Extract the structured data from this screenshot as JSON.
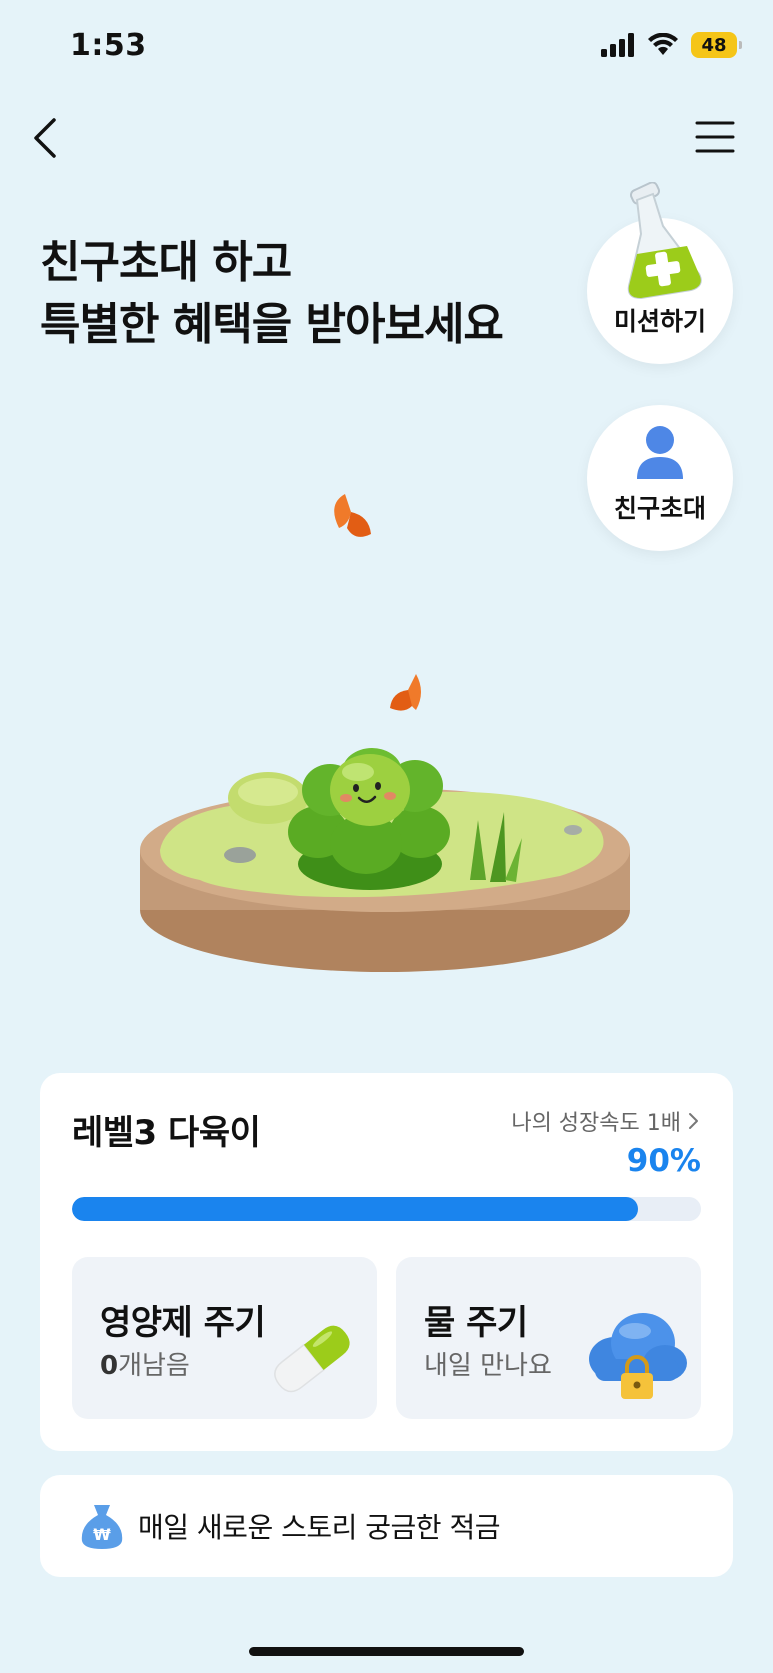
{
  "status_bar": {
    "time": "1:53",
    "battery": "48"
  },
  "headline": {
    "line1": "친구초대 하고",
    "line2": "특별한 혜택을 받아보세요"
  },
  "side_actions": {
    "mission_label": "미션하기",
    "invite_label": "친구초대"
  },
  "level_card": {
    "title": "레벨3 다육이",
    "speed_link": "나의 성장속도 1배",
    "progress_text": "90%",
    "progress_value": 0.9,
    "nutrient": {
      "title": "영양제 주기",
      "count": "0",
      "count_suffix": "개남음"
    },
    "water": {
      "title": "물 주기",
      "sub": "내일 만나요"
    }
  },
  "banner": {
    "text": "매일 새로운 스토리 궁금한 적금"
  },
  "colors": {
    "accent": "#1a84ee",
    "background": "#e5f3f9"
  }
}
